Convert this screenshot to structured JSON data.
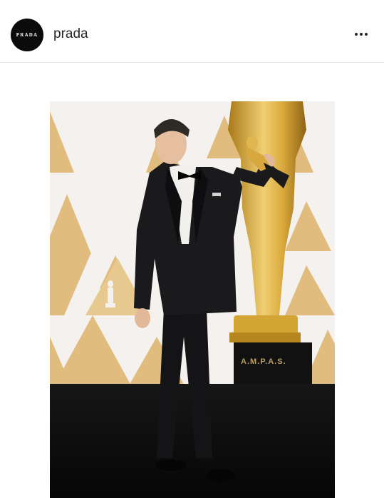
{
  "post": {
    "username": "prada",
    "avatar_text": "PRADA",
    "more_icon": "more-horizontal-icon"
  },
  "photo": {
    "plinth_text": "A.M.P.A.S."
  },
  "colors": {
    "backdrop_gold": "#e0bc7e",
    "statue_gold": "#d2a534",
    "floor": "#0c0c0c",
    "suit": "#1a1a1c"
  }
}
